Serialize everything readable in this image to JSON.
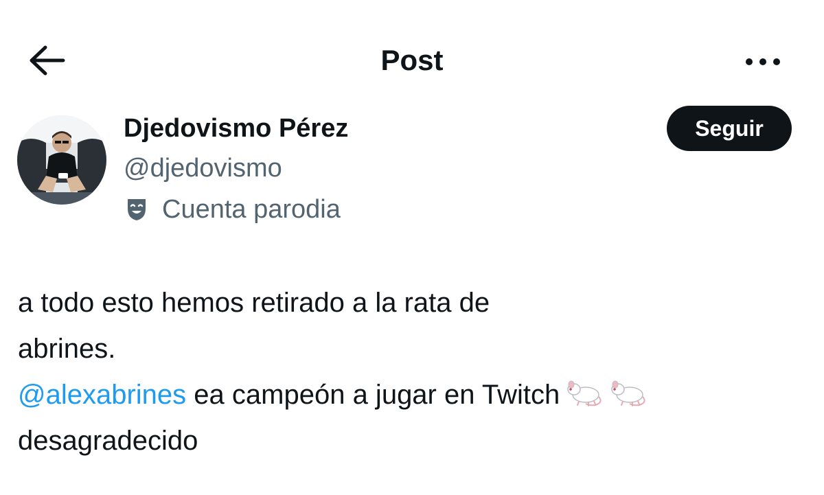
{
  "header": {
    "title": "Post",
    "back_icon": "arrow-left-icon",
    "more_icon": "more-horizontal-icon"
  },
  "author": {
    "name": "Djedovismo Pérez",
    "handle": "@djedovismo",
    "parody_label": "Cuenta parodia",
    "parody_icon": "theater-masks-icon",
    "avatar": "avatar-photo"
  },
  "follow_button": {
    "label": "Seguir"
  },
  "post": {
    "line1": "a todo esto hemos retirado a la rata de",
    "line2": "abrines.",
    "mention": "@alexabrines",
    "line3_rest": " ea campeón a jugar en Twitch",
    "line4": "desagradecido",
    "emoji_icon": "rat-emoji-icon"
  },
  "colors": {
    "text": "#0f1419",
    "secondary": "#536471",
    "link": "#1d9bf0",
    "button_bg": "#0f1419",
    "button_text": "#ffffff"
  }
}
